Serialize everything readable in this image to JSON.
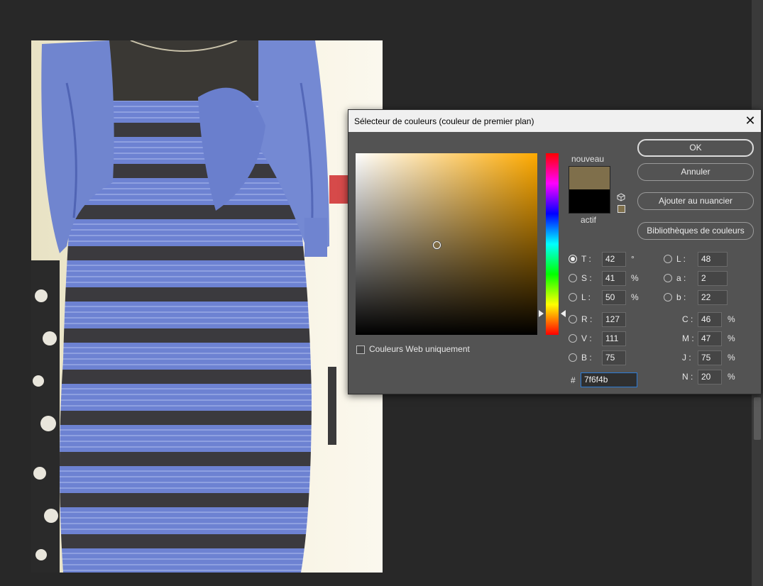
{
  "dialog": {
    "title": "Sélecteur de couleurs (couleur de premier plan)",
    "close_glyph": "✕",
    "new_label": "nouveau",
    "current_label": "actif",
    "new_color": "#7f6f4b",
    "current_color": "#000000",
    "buttons": {
      "ok": "OK",
      "cancel": "Annuler",
      "add_swatch": "Ajouter au nuancier",
      "libraries": "Bibliothèques de couleurs"
    },
    "web_only_label": "Couleurs Web uniquement",
    "hsb": {
      "h_label": "T :",
      "h_value": "42",
      "h_unit": "°",
      "s_label": "S :",
      "s_value": "41",
      "s_unit": "%",
      "b_label": "L :",
      "b_value": "50",
      "b_unit": "%"
    },
    "lab": {
      "l_label": "L :",
      "l_value": "48",
      "a_label": "a :",
      "a_value": "2",
      "b_label": "b :",
      "b_value": "22"
    },
    "rgb": {
      "r_label": "R :",
      "r_value": "127",
      "g_label": "V :",
      "g_value": "111",
      "b_label": "B :",
      "b_value": "75"
    },
    "cmyk": {
      "c_label": "C :",
      "c_value": "46",
      "c_unit": "%",
      "m_label": "M :",
      "m_value": "47",
      "m_unit": "%",
      "y_label": "J :",
      "y_value": "75",
      "y_unit": "%",
      "k_label": "N :",
      "k_value": "20",
      "k_unit": "%"
    },
    "hex_symbol": "#",
    "hex_value": "7f6f4b",
    "icons": {
      "cube": "cube-icon",
      "close": "close-icon"
    }
  }
}
